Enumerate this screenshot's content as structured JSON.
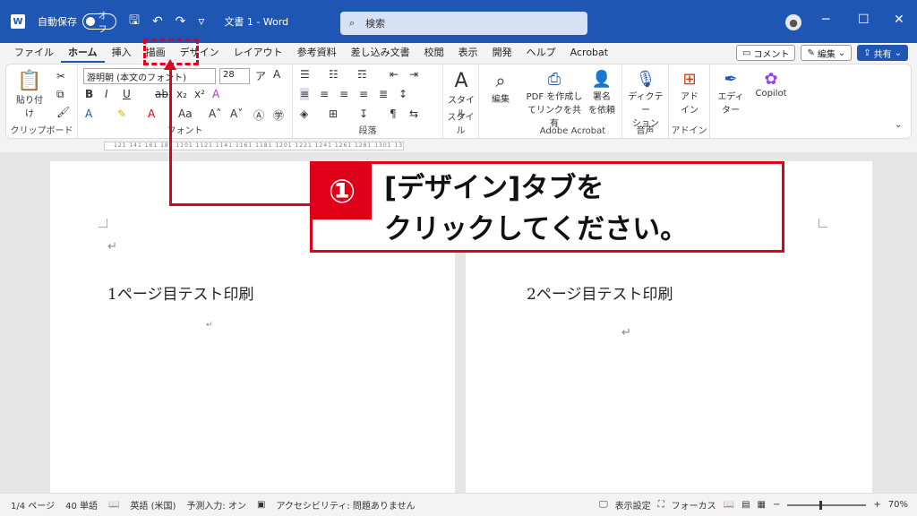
{
  "titlebar": {
    "autosave_label": "自動保存",
    "toggle_state": "オフ",
    "doc_title": "文書 1 - Word",
    "search_placeholder": "検索",
    "accent": "#1f56b4"
  },
  "menu": {
    "tabs": [
      "ファイル",
      "ホーム",
      "挿入",
      "描画",
      "デザイン",
      "レイアウト",
      "参考資料",
      "差し込み文書",
      "校閲",
      "表示",
      "開発",
      "ヘルプ",
      "Acrobat"
    ],
    "comment_label": "コメント",
    "edit_label": "編集",
    "share_label": "共有"
  },
  "ribbon": {
    "clipboard": {
      "paste_label": "貼り付け",
      "group_label": "クリップボード"
    },
    "font": {
      "font_name": "游明朝 (本文のフォント)",
      "font_size": "28",
      "group_label": "フォント"
    },
    "paragraph": {
      "group_label": "段落"
    },
    "styles": {
      "style_label": "スタイル",
      "group_label": "スタイル"
    },
    "editing": {
      "label": "編集"
    },
    "acrobat": {
      "pdf_label_1": "PDF を作成し",
      "pdf_label_2": "てリンクを共有",
      "sign_label_1": "署名",
      "sign_label_2": "を依頼",
      "group_label": "Adobe Acrobat"
    },
    "voice": {
      "dictate_label_1": "ディクテー",
      "dictate_label_2": "ション",
      "group_label": "音声"
    },
    "addins": {
      "addin_label_1": "アド",
      "addin_label_2": "イン",
      "group_label": "アドイン"
    },
    "editor": {
      "label_1": "エディ",
      "label_2": "ター"
    },
    "copilot": {
      "label": "Copilot"
    }
  },
  "ruler": {
    "ticks": "121 141 161 181 1101 1121 1141 1161 1181 1201 1221 1241 1261 1281 1301 1321 1341 1361 1381 1401"
  },
  "document": {
    "page1_text": "1ページ目テスト印刷",
    "page2_text": "2ページ目テスト印刷"
  },
  "annotation": {
    "number": "①",
    "line1": "[デザイン]タブを",
    "line2": "クリックしてください。",
    "color": "#e0001a"
  },
  "statusbar": {
    "page": "1/4 ページ",
    "words": "40 単語",
    "language": "英語 (米国)",
    "predict": "予測入力: オン",
    "accessibility": "アクセシビリティ: 問題ありません",
    "display_settings": "表示設定",
    "focus": "フォーカス",
    "zoom": "70%"
  }
}
